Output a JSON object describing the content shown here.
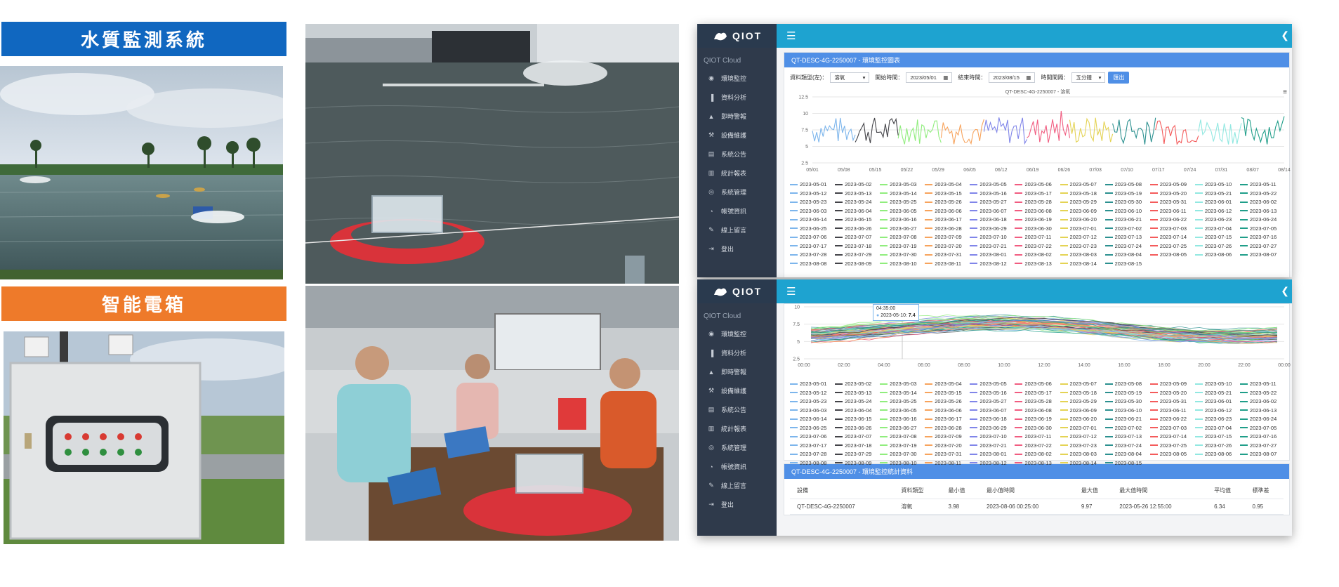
{
  "banners": {
    "water": "水質監測系統",
    "box": "智能電箱"
  },
  "dashboard": {
    "brand": "QIOT",
    "cloud_title": "QIOT Cloud",
    "nav": [
      {
        "label": "環境監控",
        "icon": "eye-icon"
      },
      {
        "label": "資料分析",
        "icon": "bar-chart-icon"
      },
      {
        "label": "即時警報",
        "icon": "bell-icon"
      },
      {
        "label": "設備維護",
        "icon": "wrench-icon"
      },
      {
        "label": "系統公告",
        "icon": "announcement-icon"
      },
      {
        "label": "統計報表",
        "icon": "report-icon"
      },
      {
        "label": "系統管理",
        "icon": "globe-icon"
      },
      {
        "label": "帳號資訊",
        "icon": "user-icon"
      },
      {
        "label": "線上留言",
        "icon": "edit-icon"
      },
      {
        "label": "登出",
        "icon": "logout-icon"
      }
    ],
    "chart_panel": {
      "header": "QT-DESC-4G-2250007 - 環境監控圖表",
      "filters": {
        "type_label": "資料類型(左)：",
        "type_value": "溶氧",
        "start_label": "開始時間：",
        "start_value": "2023/05/01",
        "end_label": "結束時間：",
        "end_value": "2023/08/15",
        "interval_label": "時間間隔：",
        "interval_value": "五分鐘",
        "export_label": "匯出"
      },
      "chart_title": "QT-DESC-4G-2250007 - 溶氧"
    },
    "tooltip": {
      "time": "04:35:00",
      "label": "2023-05-10:",
      "value": "7.4"
    },
    "stats_panel": {
      "header": "QT-DESC-4G-2250007 - 環境監控統計資料",
      "columns": [
        "設備",
        "資料類型",
        "最小值",
        "最小值時間",
        "最大值",
        "最大值時間",
        "平均值",
        "標準差"
      ],
      "row": [
        "QT-DESC-4G-2250007",
        "溶氧",
        "3.98",
        "2023-08-06 00:25:00",
        "9.97",
        "2023-05-26 12:55:00",
        "6.34",
        "0.95"
      ]
    }
  },
  "chart_data": [
    {
      "type": "line",
      "title": "QT-DESC-4G-2250007 - 溶氧",
      "x_ticks": [
        "05/01",
        "05/08",
        "05/15",
        "05/22",
        "05/29",
        "06/05",
        "06/12",
        "06/19",
        "06/26",
        "07/03",
        "07/10",
        "07/17",
        "07/24",
        "07/31",
        "08/07",
        "08/14"
      ],
      "y_ticks": [
        2.5,
        5,
        7.5,
        10,
        12.5
      ],
      "ylim": [
        2.5,
        12.5
      ],
      "description_series": "daily dissolved-oxygen series 2023-05-01 .. 2023-08-15",
      "legend_position": "bottom"
    },
    {
      "type": "line",
      "x_ticks": [
        "00:00",
        "02:00",
        "04:00",
        "06:00",
        "08:00",
        "10:00",
        "12:00",
        "14:00",
        "16:00",
        "18:00",
        "20:00",
        "22:00",
        "00:00"
      ],
      "y_ticks": [
        2.5,
        5,
        7.5,
        10
      ],
      "ylim": [
        2.5,
        10
      ],
      "legend_position": "bottom"
    }
  ],
  "legend_colors": [
    "#7cb5ec",
    "#434348",
    "#90ed7d",
    "#f7a35c",
    "#8085e9",
    "#f15c80",
    "#e4d354",
    "#2b908f",
    "#f45b5b",
    "#91e8e1",
    "#1f9e89"
  ]
}
